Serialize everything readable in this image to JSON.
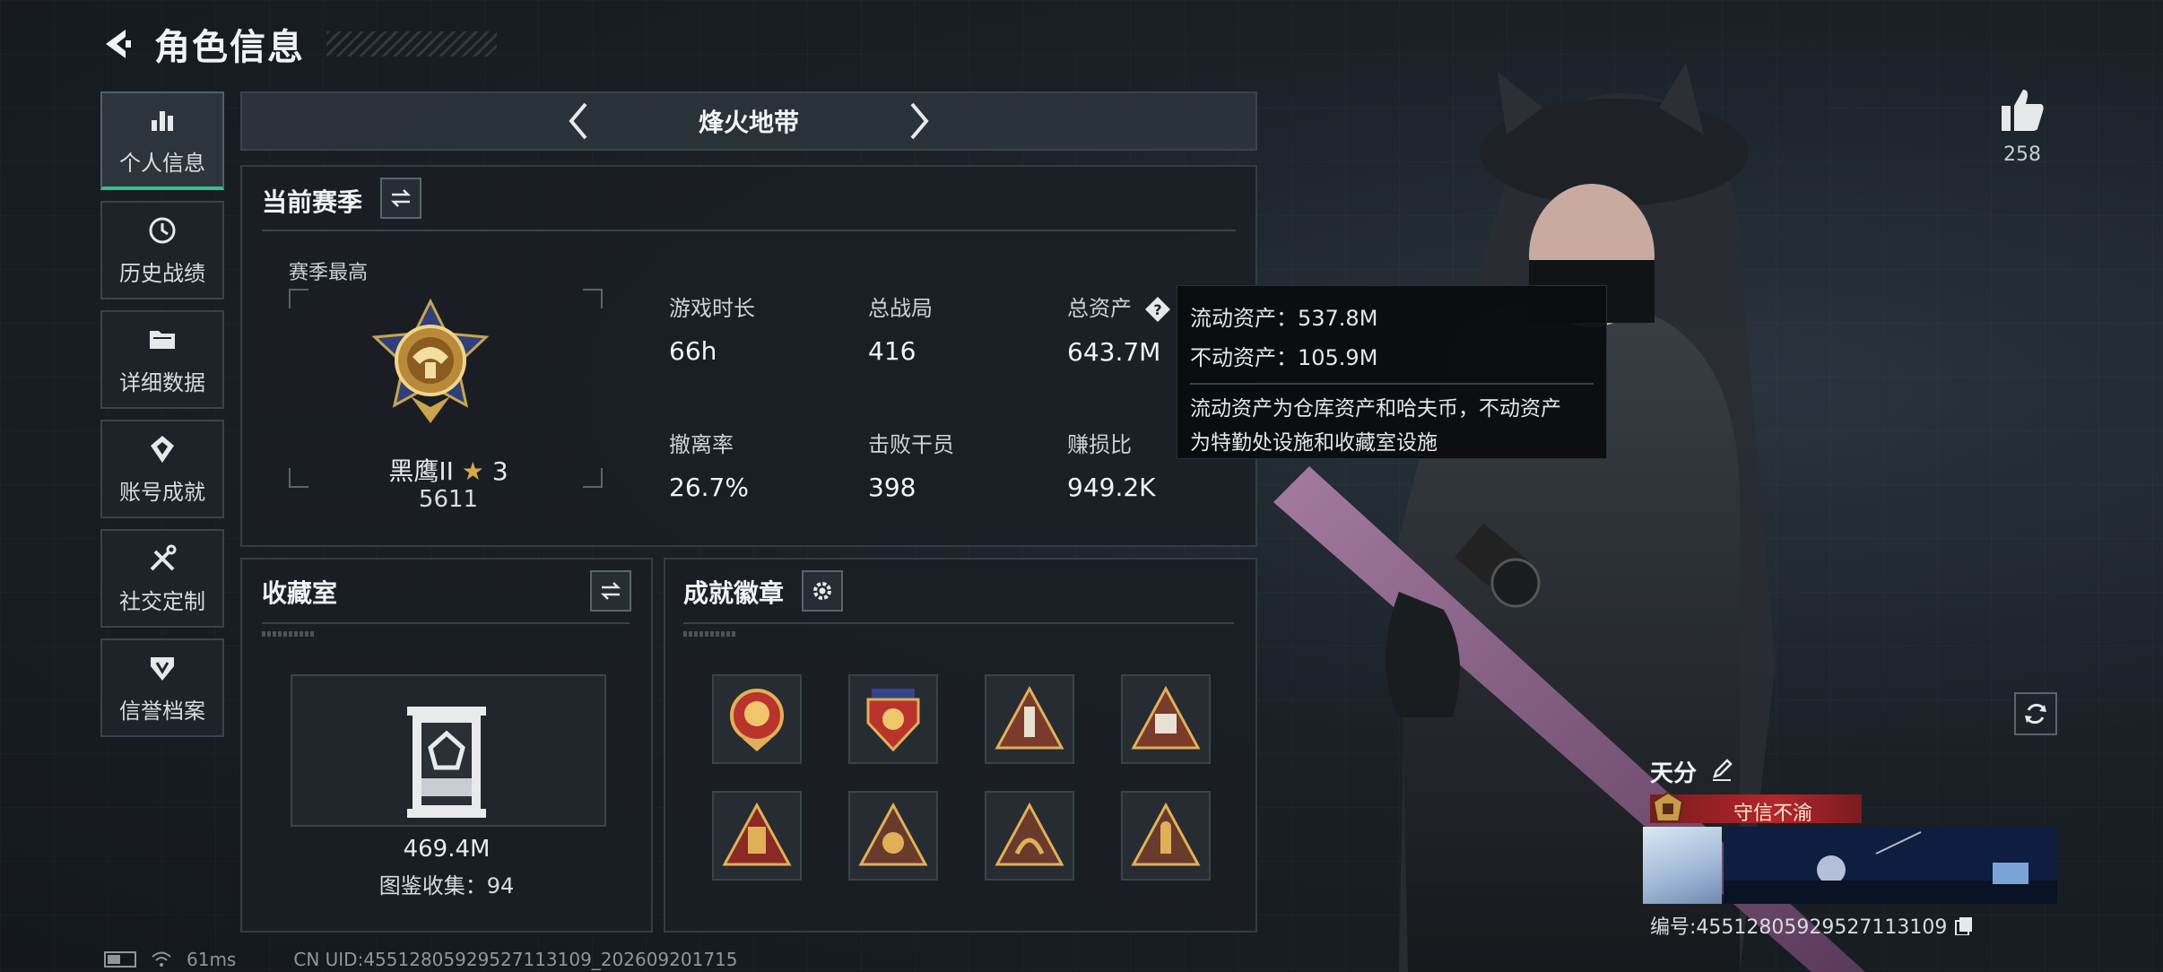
{
  "header": {
    "title": "角色信息"
  },
  "sidebar": {
    "items": [
      {
        "label": "个人信息",
        "icon": "bar-chart-icon",
        "active": true
      },
      {
        "label": "历史战绩",
        "icon": "clock-icon"
      },
      {
        "label": "详细数据",
        "icon": "folder-icon"
      },
      {
        "label": "账号成就",
        "icon": "achievement-icon"
      },
      {
        "label": "社交定制",
        "icon": "tools-icon"
      },
      {
        "label": "信誉档案",
        "icon": "shield-icon"
      }
    ]
  },
  "mode": {
    "label": "烽火地带"
  },
  "season": {
    "title": "当前赛季",
    "best_label": "赛季最高",
    "rank_name": "黑鹰II",
    "rank_star": "★",
    "rank_stars": "3",
    "rank_score": "5611",
    "stats": [
      {
        "label": "游戏时长",
        "value": "66h"
      },
      {
        "label": "总战局",
        "value": "416"
      },
      {
        "label": "总资产",
        "value": "643.7M"
      },
      {
        "label": "撤离率",
        "value": "26.7%"
      },
      {
        "label": "击败干员",
        "value": "398"
      },
      {
        "label": "赚损比",
        "value": "949.2K"
      }
    ]
  },
  "tooltip": {
    "line1": "流动资产：537.8M",
    "line2": "不动资产：105.9M",
    "desc1": "流动资产为仓库资产和哈夫币，不动资产",
    "desc2": "为特勤处设施和收藏室设施"
  },
  "collection": {
    "title": "收藏室",
    "value": "469.4M",
    "count": "图鉴收集：94"
  },
  "achievements": {
    "title": "成就徽章"
  },
  "social": {
    "likes": "258",
    "player_name": "天分",
    "credit": "守信不渝",
    "uid": "编号:4551280592952711310​9"
  },
  "status": {
    "ping": "61ms",
    "uid_line": "CN UID:4551280592952711310​9_202609201715"
  },
  "colors": {
    "accent": "#2ec28a",
    "credit_red": "#b3262a",
    "gold": "#d9a84a"
  }
}
